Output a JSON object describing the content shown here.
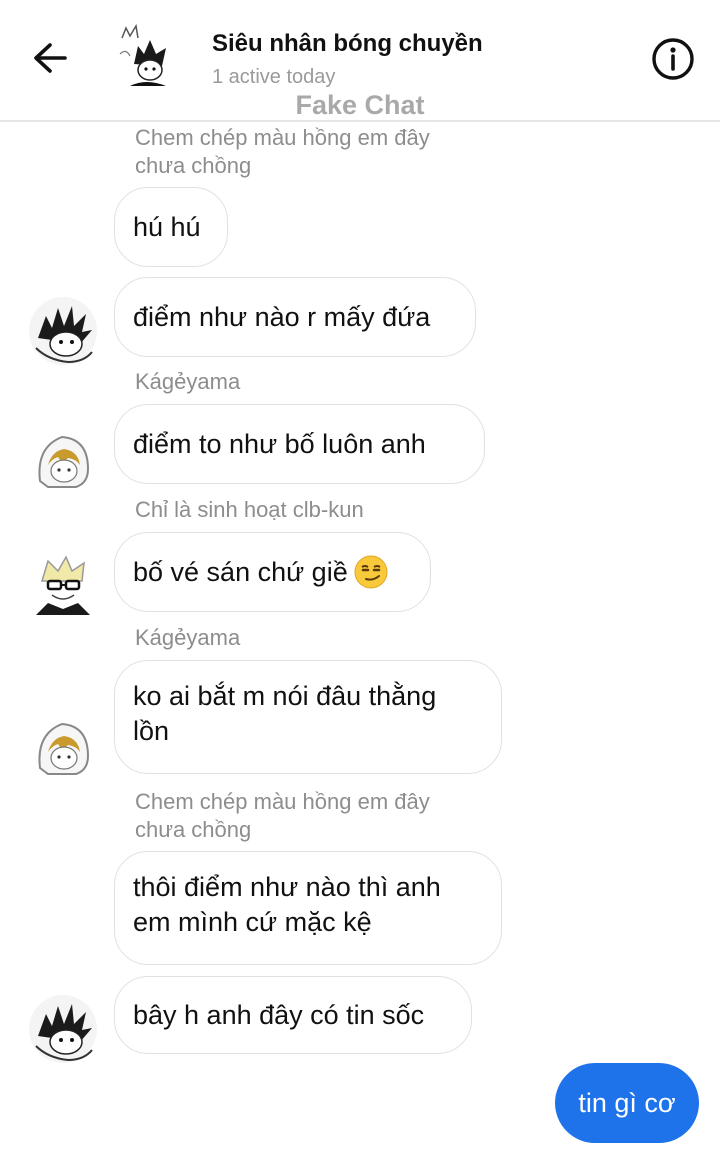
{
  "header": {
    "title": "Siêu nhân bóng chuyền",
    "status": "1 active today",
    "watermark": "Fake Chat"
  },
  "messages": [
    {
      "sender": "Chem chép màu hồng em đây\nchưa chồng",
      "text": "hú hú"
    },
    {
      "sender": "",
      "text": "điểm như nào r mấy đứa",
      "avatar": "spiky-hair-avatar-icon"
    },
    {
      "sender": "Kágẻyama",
      "text": "điểm to như bố luôn anh",
      "avatar": "hooded-avatar-icon"
    },
    {
      "sender": "Chỉ là sinh hoạt clb-kun",
      "text": "bố vé sán chứ giề",
      "emoji": "smirk-emoji-icon",
      "avatar": "glasses-avatar-icon"
    },
    {
      "sender": "Kágẻyama",
      "text_lines": [
        "ko ai bắt m nói đâu thằng",
        "lồn"
      ],
      "avatar": "hooded-avatar-icon"
    },
    {
      "sender": "Chem chép màu hồng em đây\nchưa chồng",
      "text_lines": [
        "thôi điểm như nào thì anh",
        "em mình cứ mặc kệ"
      ]
    },
    {
      "sender": "",
      "text": "bây h anh đây có tin sốc",
      "avatar": "spiky-hair-avatar-icon"
    }
  ],
  "outgoing": {
    "text": "tin gì cơ",
    "color": "#1e72ea"
  },
  "sender_labels": {
    "s1_line1": "Chem chép màu hồng em đây",
    "s1_line2": "chưa chồng",
    "s3": "Kágẻyama",
    "s4": "Chỉ là sinh hoạt clb-kun",
    "s5": "Kágẻyama",
    "s6_line1": "Chem chép màu hồng em đây",
    "s6_line2": "chưa chồng"
  },
  "bubbles": {
    "m1": "hú hú",
    "m2": "điểm như nào r mấy đứa",
    "m3": "điểm to như bố luôn anh",
    "m4": "bố vé sán chứ giề",
    "m5_line1": "ko ai bắt m nói đâu thằng",
    "m5_line2": "lồn",
    "m6_line1": "thôi điểm như nào thì anh",
    "m6_line2": "em mình cứ mặc kệ",
    "m7": "bây h anh đây có tin sốc"
  }
}
